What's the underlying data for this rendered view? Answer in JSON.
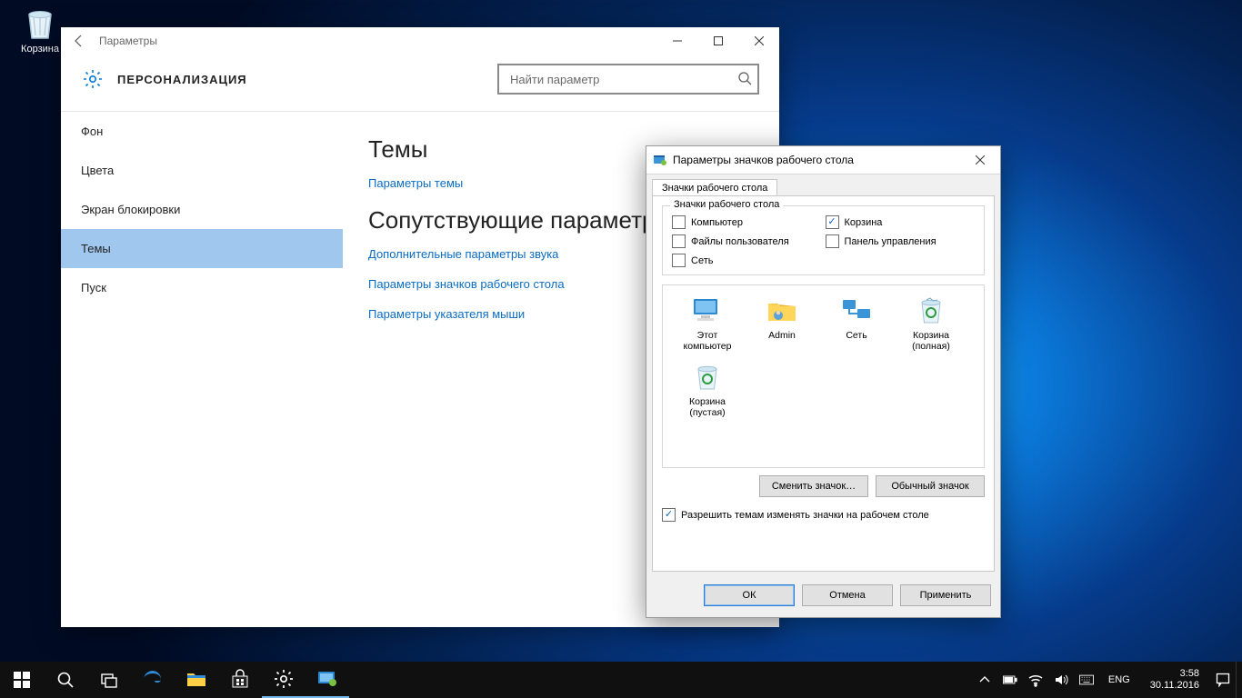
{
  "desktop": {
    "recycle_bin_label": "Корзина"
  },
  "settings": {
    "window_title": "Параметры",
    "header_title": "ПЕРСОНАЛИЗАЦИЯ",
    "search_placeholder": "Найти параметр",
    "sidebar": [
      {
        "label": "Фон",
        "selected": false
      },
      {
        "label": "Цвета",
        "selected": false
      },
      {
        "label": "Экран блокировки",
        "selected": false
      },
      {
        "label": "Темы",
        "selected": true
      },
      {
        "label": "Пуск",
        "selected": false
      }
    ],
    "content": {
      "heading_themes": "Темы",
      "link_theme_settings": "Параметры темы",
      "heading_related": "Сопутствующие параметры",
      "link_sound": "Дополнительные параметры звука",
      "link_desktop_icons": "Параметры значков рабочего стола",
      "link_mouse": "Параметры указателя мыши"
    }
  },
  "dlg": {
    "title": "Параметры значков рабочего стола",
    "tab_label": "Значки рабочего стола",
    "group_legend": "Значки рабочего стола",
    "checks": {
      "computer": {
        "label": "Компьютер",
        "checked": false
      },
      "recycle": {
        "label": "Корзина",
        "checked": true
      },
      "userfiles": {
        "label": "Файлы пользователя",
        "checked": false
      },
      "cpanel": {
        "label": "Панель управления",
        "checked": false
      },
      "network": {
        "label": "Сеть",
        "checked": false
      }
    },
    "icons": [
      {
        "name": "Этот\nкомпьютер"
      },
      {
        "name": "Admin"
      },
      {
        "name": "Сеть"
      },
      {
        "name": "Корзина\n(полная)"
      },
      {
        "name": "Корзина\n(пустая)"
      }
    ],
    "btn_change": "Сменить значок…",
    "btn_default": "Обычный значок",
    "allow_themes": {
      "label": "Разрешить темам изменять значки на рабочем столе",
      "checked": true
    },
    "btn_ok": "ОК",
    "btn_cancel": "Отмена",
    "btn_apply": "Применить"
  },
  "taskbar": {
    "lang": "ENG",
    "time": "3:58",
    "date": "30.11.2016"
  }
}
